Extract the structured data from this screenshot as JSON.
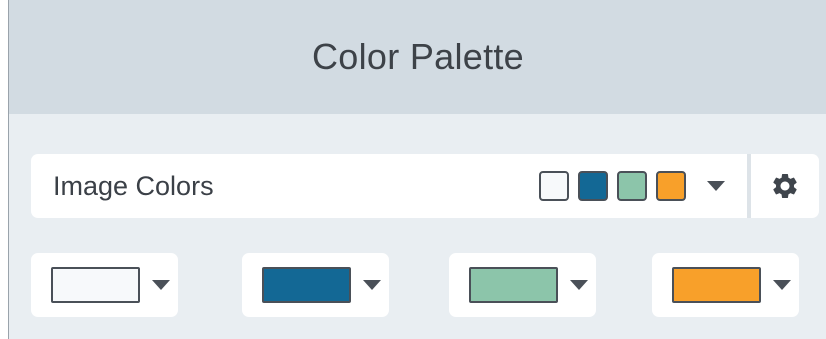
{
  "panel": {
    "title": "Color Palette"
  },
  "palette_selector": {
    "selected_label": "Image Colors",
    "preview_icons": [
      "swatch-white",
      "swatch-blue",
      "swatch-green",
      "swatch-orange"
    ],
    "dropdown_icon": "triangle-down-icon",
    "settings_icon": "gear-icon"
  },
  "colors": {
    "white": "#f7f9fb",
    "blue": "#136895",
    "green": "#8cc5aa",
    "orange": "#f8a02a"
  },
  "color_buttons": [
    {
      "name": "white",
      "color": "#f7f9fb"
    },
    {
      "name": "blue",
      "color": "#136895"
    },
    {
      "name": "green",
      "color": "#8cc5aa"
    },
    {
      "name": "orange",
      "color": "#f8a02a"
    }
  ]
}
